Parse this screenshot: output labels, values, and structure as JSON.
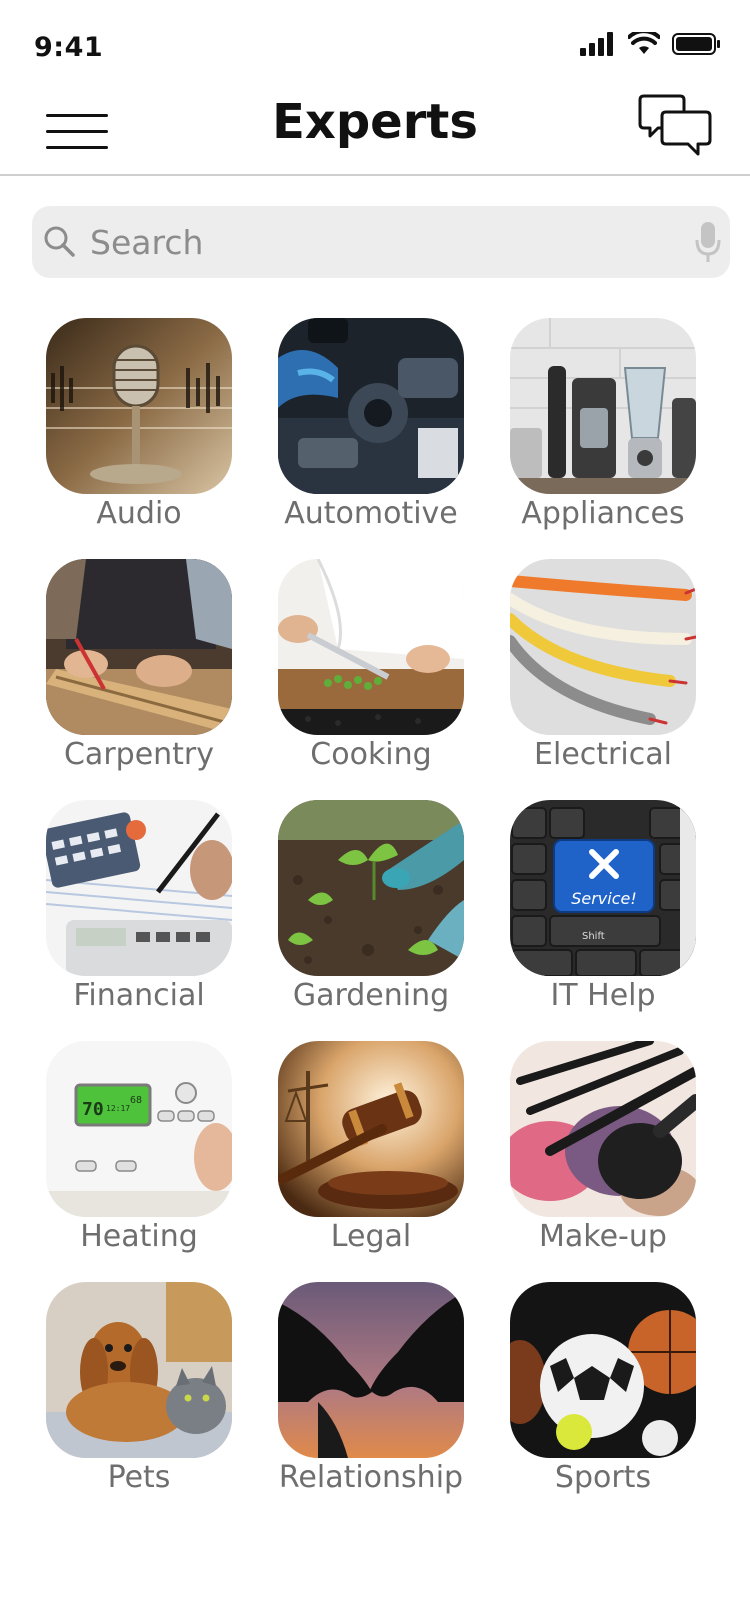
{
  "status_bar": {
    "time": "9:41",
    "icons": [
      "cellular-signal-icon",
      "wifi-icon",
      "battery-icon"
    ]
  },
  "header": {
    "title": "Experts",
    "left_icon": "hamburger-menu-icon",
    "right_icon": "chat-bubbles-icon"
  },
  "search": {
    "placeholder": "Search",
    "value": "",
    "left_icon": "search-icon",
    "right_icon": "microphone-icon"
  },
  "categories": [
    {
      "label": "Audio",
      "icon": "microphone-photo"
    },
    {
      "label": "Automotive",
      "icon": "engine-photo"
    },
    {
      "label": "Appliances",
      "icon": "kitchen-appliances-photo"
    },
    {
      "label": "Carpentry",
      "icon": "woodworking-photo"
    },
    {
      "label": "Cooking",
      "icon": "chef-chopping-photo"
    },
    {
      "label": "Electrical",
      "icon": "wires-photo"
    },
    {
      "label": "Financial",
      "icon": "calculator-photo"
    },
    {
      "label": "Gardening",
      "icon": "planting-photo"
    },
    {
      "label": "IT Help",
      "icon": "keyboard-service-key-photo"
    },
    {
      "label": "Heating",
      "icon": "thermostat-photo"
    },
    {
      "label": "Legal",
      "icon": "gavel-photo"
    },
    {
      "label": "Make-up",
      "icon": "makeup-brushes-photo"
    },
    {
      "label": "Pets",
      "icon": "dog-and-cat-photo"
    },
    {
      "label": "Relationship",
      "icon": "holding-hands-photo"
    },
    {
      "label": "Sports",
      "icon": "sports-balls-photo"
    }
  ],
  "image_text": {
    "thermostat_reading": "70",
    "thermostat_time": "12:17",
    "thermostat_setpoint": "68",
    "service_key": "Service!",
    "shift_key": "Shift"
  },
  "colors": {
    "text_primary": "#111111",
    "label_gray": "#6e6e6e",
    "search_bg": "#ededed",
    "divider": "#cfcfcf",
    "service_key_blue": "#1f63c8"
  }
}
